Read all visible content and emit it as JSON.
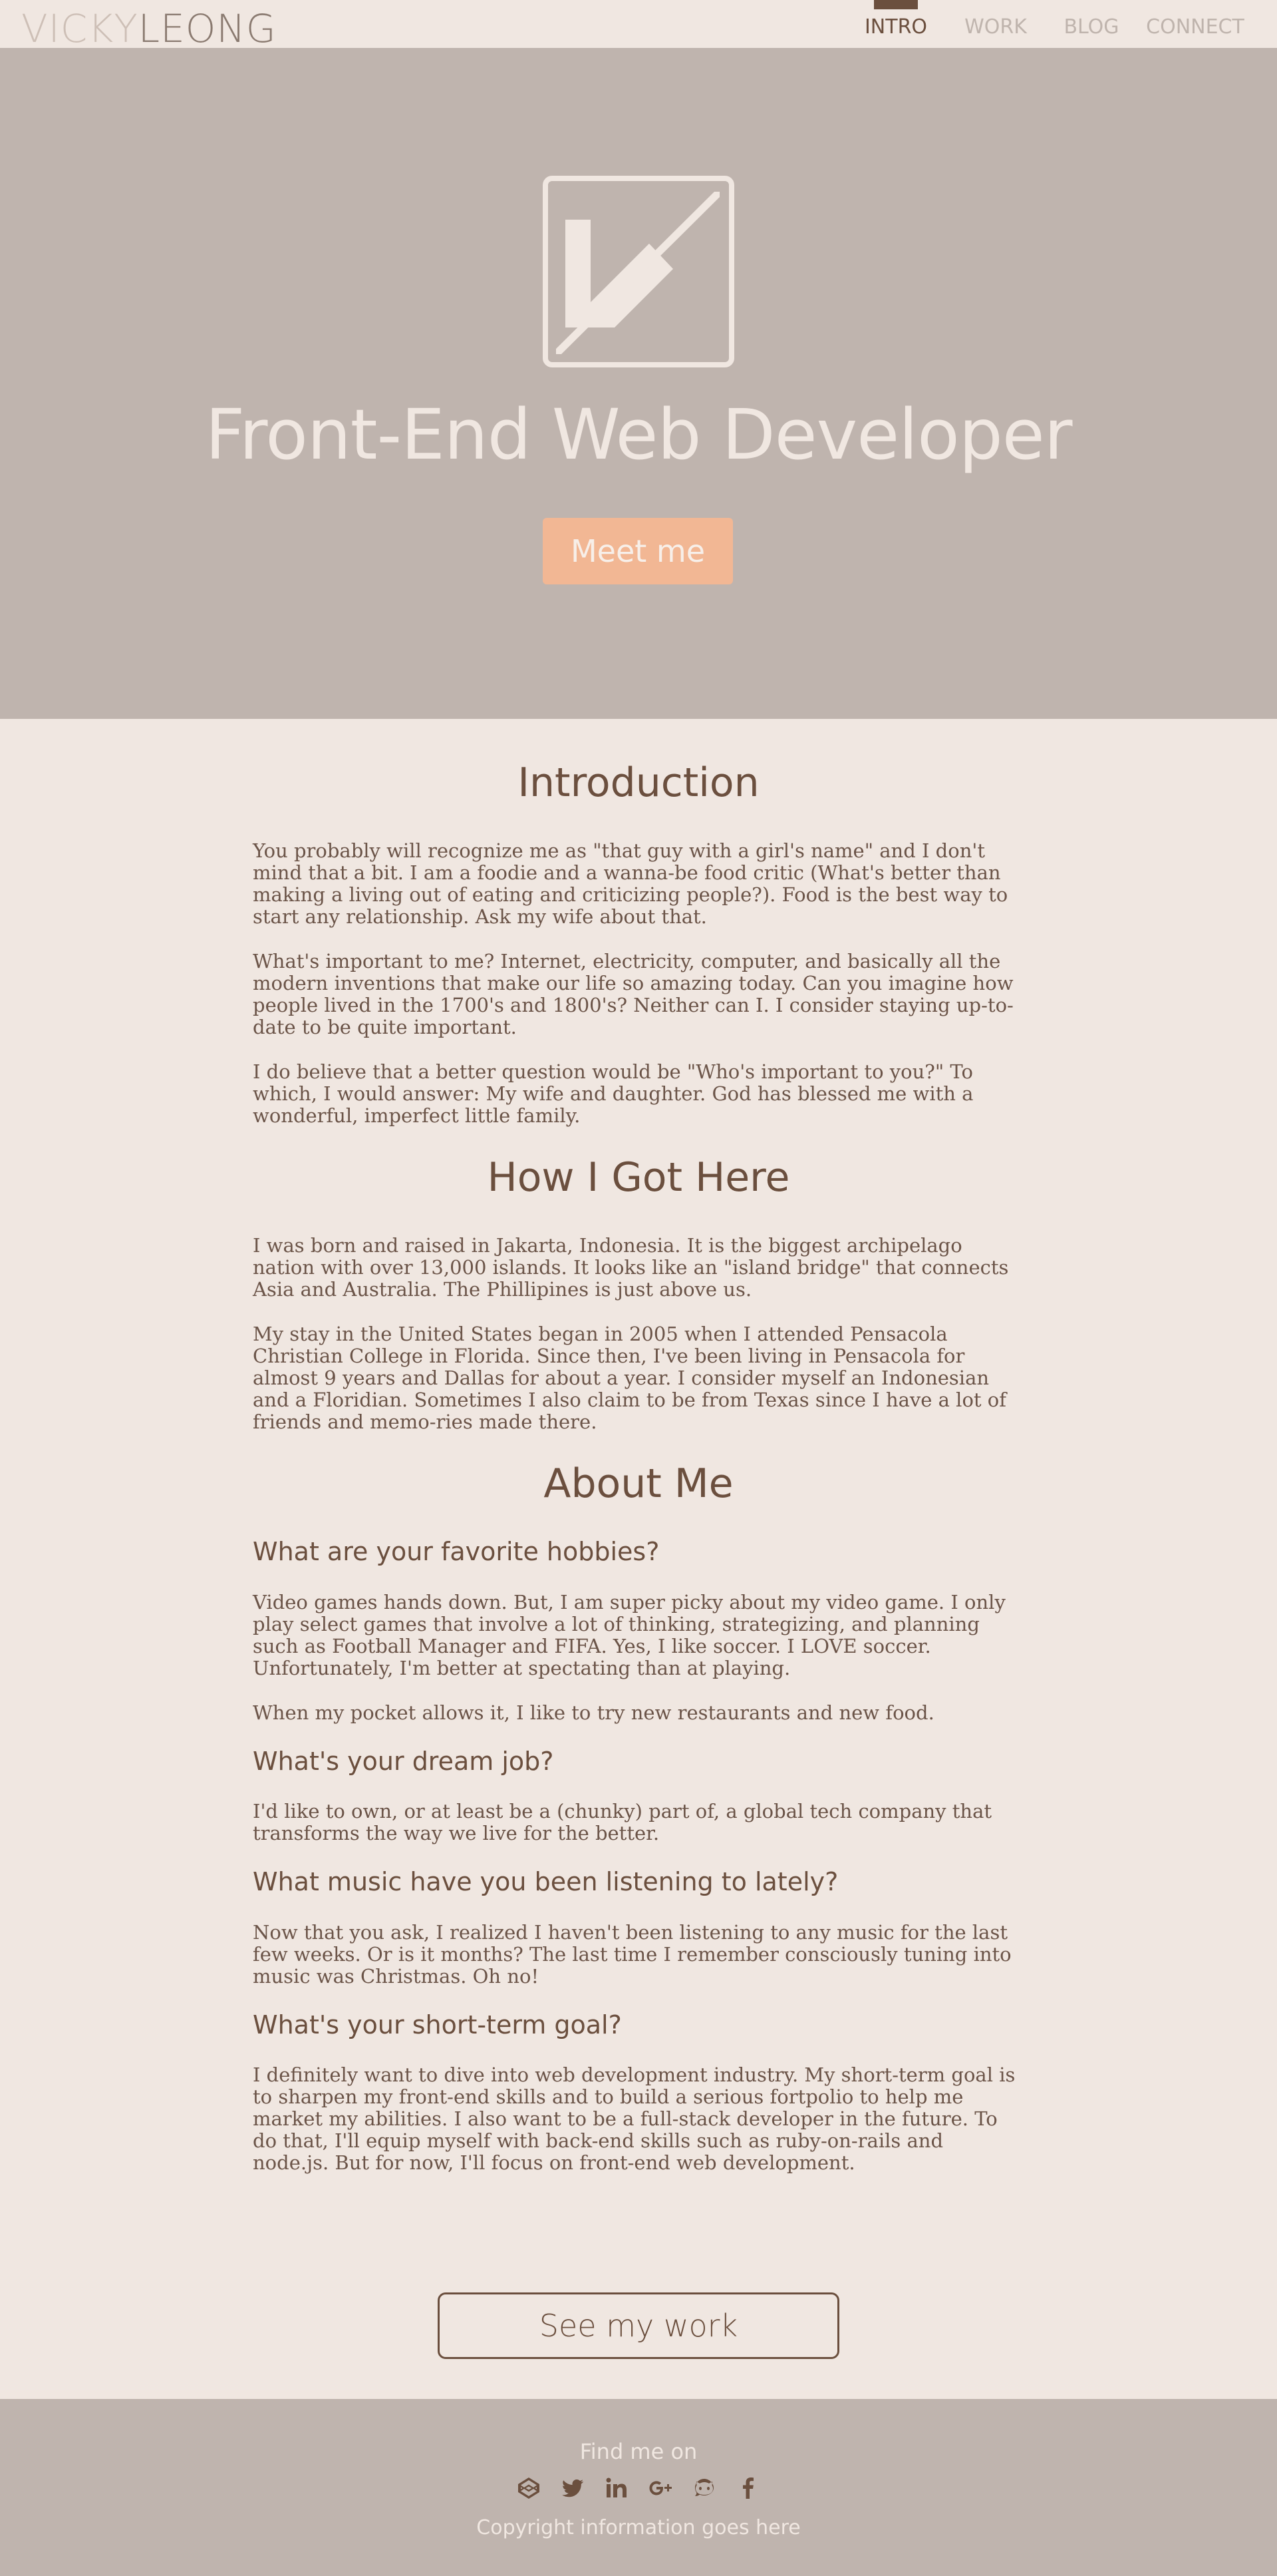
{
  "header": {
    "logo_first": "VICKY",
    "logo_last": "LEONG",
    "nav": [
      {
        "label": "INTRO",
        "active": true
      },
      {
        "label": "WORK",
        "active": false
      },
      {
        "label": "BLOG",
        "active": false
      },
      {
        "label": "CONNECT",
        "active": false
      }
    ]
  },
  "hero": {
    "title": "Front-End Web Developer",
    "button_label": "Meet me"
  },
  "intro": {
    "heading": "Introduction",
    "paragraphs": [
      "You probably will recognize me as \"that guy with a girl's name\" and I don't mind that a bit. I am a foodie and a wanna-be food critic (What's better than making a living out of eating and criticizing people?). Food is the best way to start any relationship. Ask my wife about that.",
      "What's important to me? Internet, electricity, computer, and basically all the modern inventions that make our life so amazing today. Can you imagine how people lived in the 1700's and 1800's? Neither can I. I consider staying up-to-date to be quite important.",
      "I do believe that a better question would be \"Who's important to you?\" To which, I would answer: My wife and daughter. God has blessed me with a wonderful, imperfect little family."
    ]
  },
  "how": {
    "heading": "How I Got Here",
    "paragraphs": [
      "I was born and raised in Jakarta, Indonesia. It is the biggest archipelago nation with over 13,000 islands. It looks like an \"island bridge\" that connects Asia and Australia. The Phillipines is just above us.",
      "My stay in the United States began in 2005 when I attended Pensacola Christian College in Florida. Since then, I've been living in Pensacola for almost 9 years and Dallas for about a year. I consider myself an Indonesian and a Floridian. Sometimes I also claim to be from Texas since I have a lot of friends and memo-ries made there."
    ]
  },
  "about": {
    "heading": "About Me",
    "qa": [
      {
        "question": "What are your favorite hobbies?",
        "answers": [
          "Video games hands down. But, I am super picky about my video game. I only play select games that involve a lot of thinking, strategizing, and planning such as Football Manager and FIFA. Yes, I like soccer. I LOVE soccer. Unfortunately, I'm better at spectating than at playing.",
          "When my pocket allows it, I like to try new restaurants and new food."
        ]
      },
      {
        "question": "What's your dream job?",
        "answers": [
          "I'd like to own, or at least be a (chunky) part of, a global tech company that transforms the way we live for the better."
        ]
      },
      {
        "question": "What music have you been listening to lately?",
        "answers": [
          "Now that you ask, I realized I haven't been listening to any music for the last few weeks. Or is it months? The last time I remember consciously tuning into music was Christmas. Oh no!"
        ]
      },
      {
        "question": "What's your short-term goal?",
        "answers": [
          "I definitely want to dive into web development industry. My short-term goal is to sharpen my front-end skills and to build a serious fortpolio to help me market my abilities. I also want to be a full-stack developer in the future. To do that, I'll equip myself with back-end skills such as ruby-on-rails and node.js. But for now, I'll focus on front-end web development."
        ]
      }
    ]
  },
  "work_button_label": "See my work",
  "footer": {
    "find_label": "Find me on",
    "socials": [
      "codepen-icon",
      "twitter-icon",
      "linkedin-icon",
      "google-plus-icon",
      "github-icon",
      "facebook-icon"
    ],
    "copyright": "Copyright information goes here"
  },
  "colors": {
    "background": "#f0e7e1",
    "hero_background": "#bfb4ae",
    "accent_brown": "#6b4f3e",
    "button_peach": "#f2b794"
  }
}
